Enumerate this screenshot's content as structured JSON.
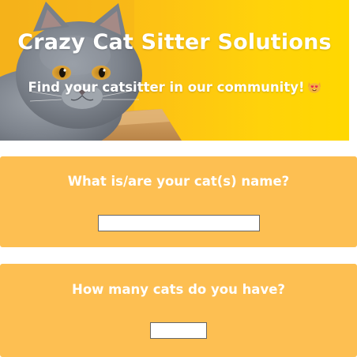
{
  "hero": {
    "title": "Crazy Cat Sitter Solutions",
    "subtitle": "Find your catsitter in our community!",
    "subtitle_emoji": "heart-eyes-cat-emoji",
    "background_color": "#ffcf0f"
  },
  "questions": [
    {
      "label": "What is/are your cat(s) name?",
      "value": "",
      "placeholder": ""
    },
    {
      "label": "How many cats do you have?",
      "value": "",
      "placeholder": ""
    }
  ],
  "colors": {
    "card_background": "#fdbf52",
    "text": "#ffffff"
  }
}
